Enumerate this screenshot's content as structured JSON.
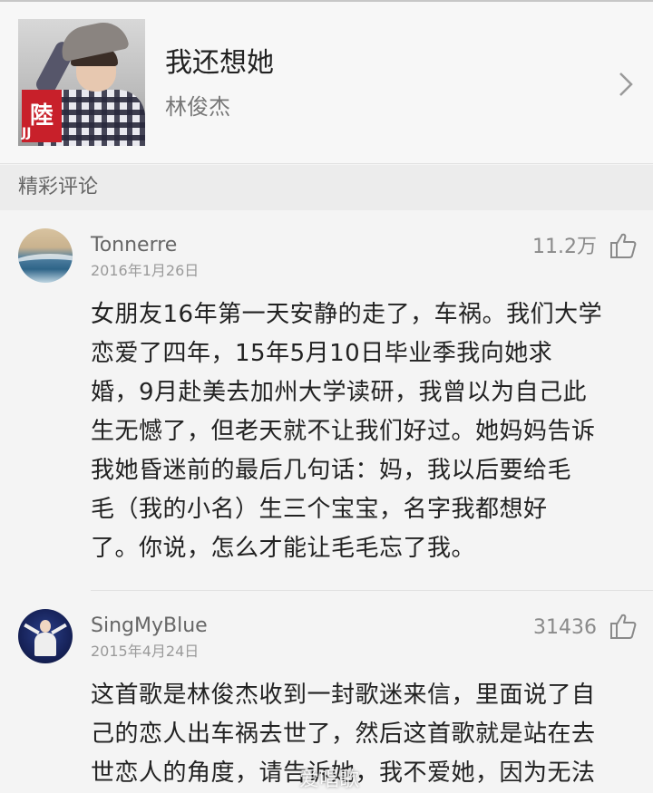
{
  "song": {
    "title": "我还想她",
    "artist": "林俊杰",
    "cover_icon": "album-cover-image"
  },
  "section": {
    "label": "精彩评论"
  },
  "comments": [
    {
      "username": "Tonnerre",
      "date": "2016年1月26日",
      "likes": "11.2万",
      "avatar": "wave-avatar",
      "lines": [
        "女朋友16年第一天安静的走了，车祸。我们大学",
        "恋爱了四年，15年5月10日毕业季我向她求",
        "婚，9月赴美去加州大学读研，我曾以为自己此",
        "生无憾了，但老天就不让我们好过。她妈妈告诉",
        "我她昏迷前的最后几句话：妈，我以后要给毛",
        "毛（我的小名）生三个宝宝，名字我都想好",
        "了。你说，怎么才能让毛毛忘了我。"
      ]
    },
    {
      "username": "SingMyBlue",
      "date": "2015年4月24日",
      "likes": "31436",
      "avatar": "person-avatar",
      "lines": [
        "这首歌是林俊杰收到一封歌迷来信，里面说了自",
        "己的恋人出车祸去世了，然后这首歌就是站在去",
        "世恋人的角度，请告诉她，我不爱她，因为无法"
      ]
    }
  ],
  "icons": {
    "chevron": "chevron-right-icon",
    "like": "thumbs-up-icon"
  },
  "colors": {
    "text_primary": "#222222",
    "text_secondary": "#666666",
    "text_muted": "#9a9a9a",
    "section_bg": "#ececec"
  },
  "watermark": "爱唱歌"
}
